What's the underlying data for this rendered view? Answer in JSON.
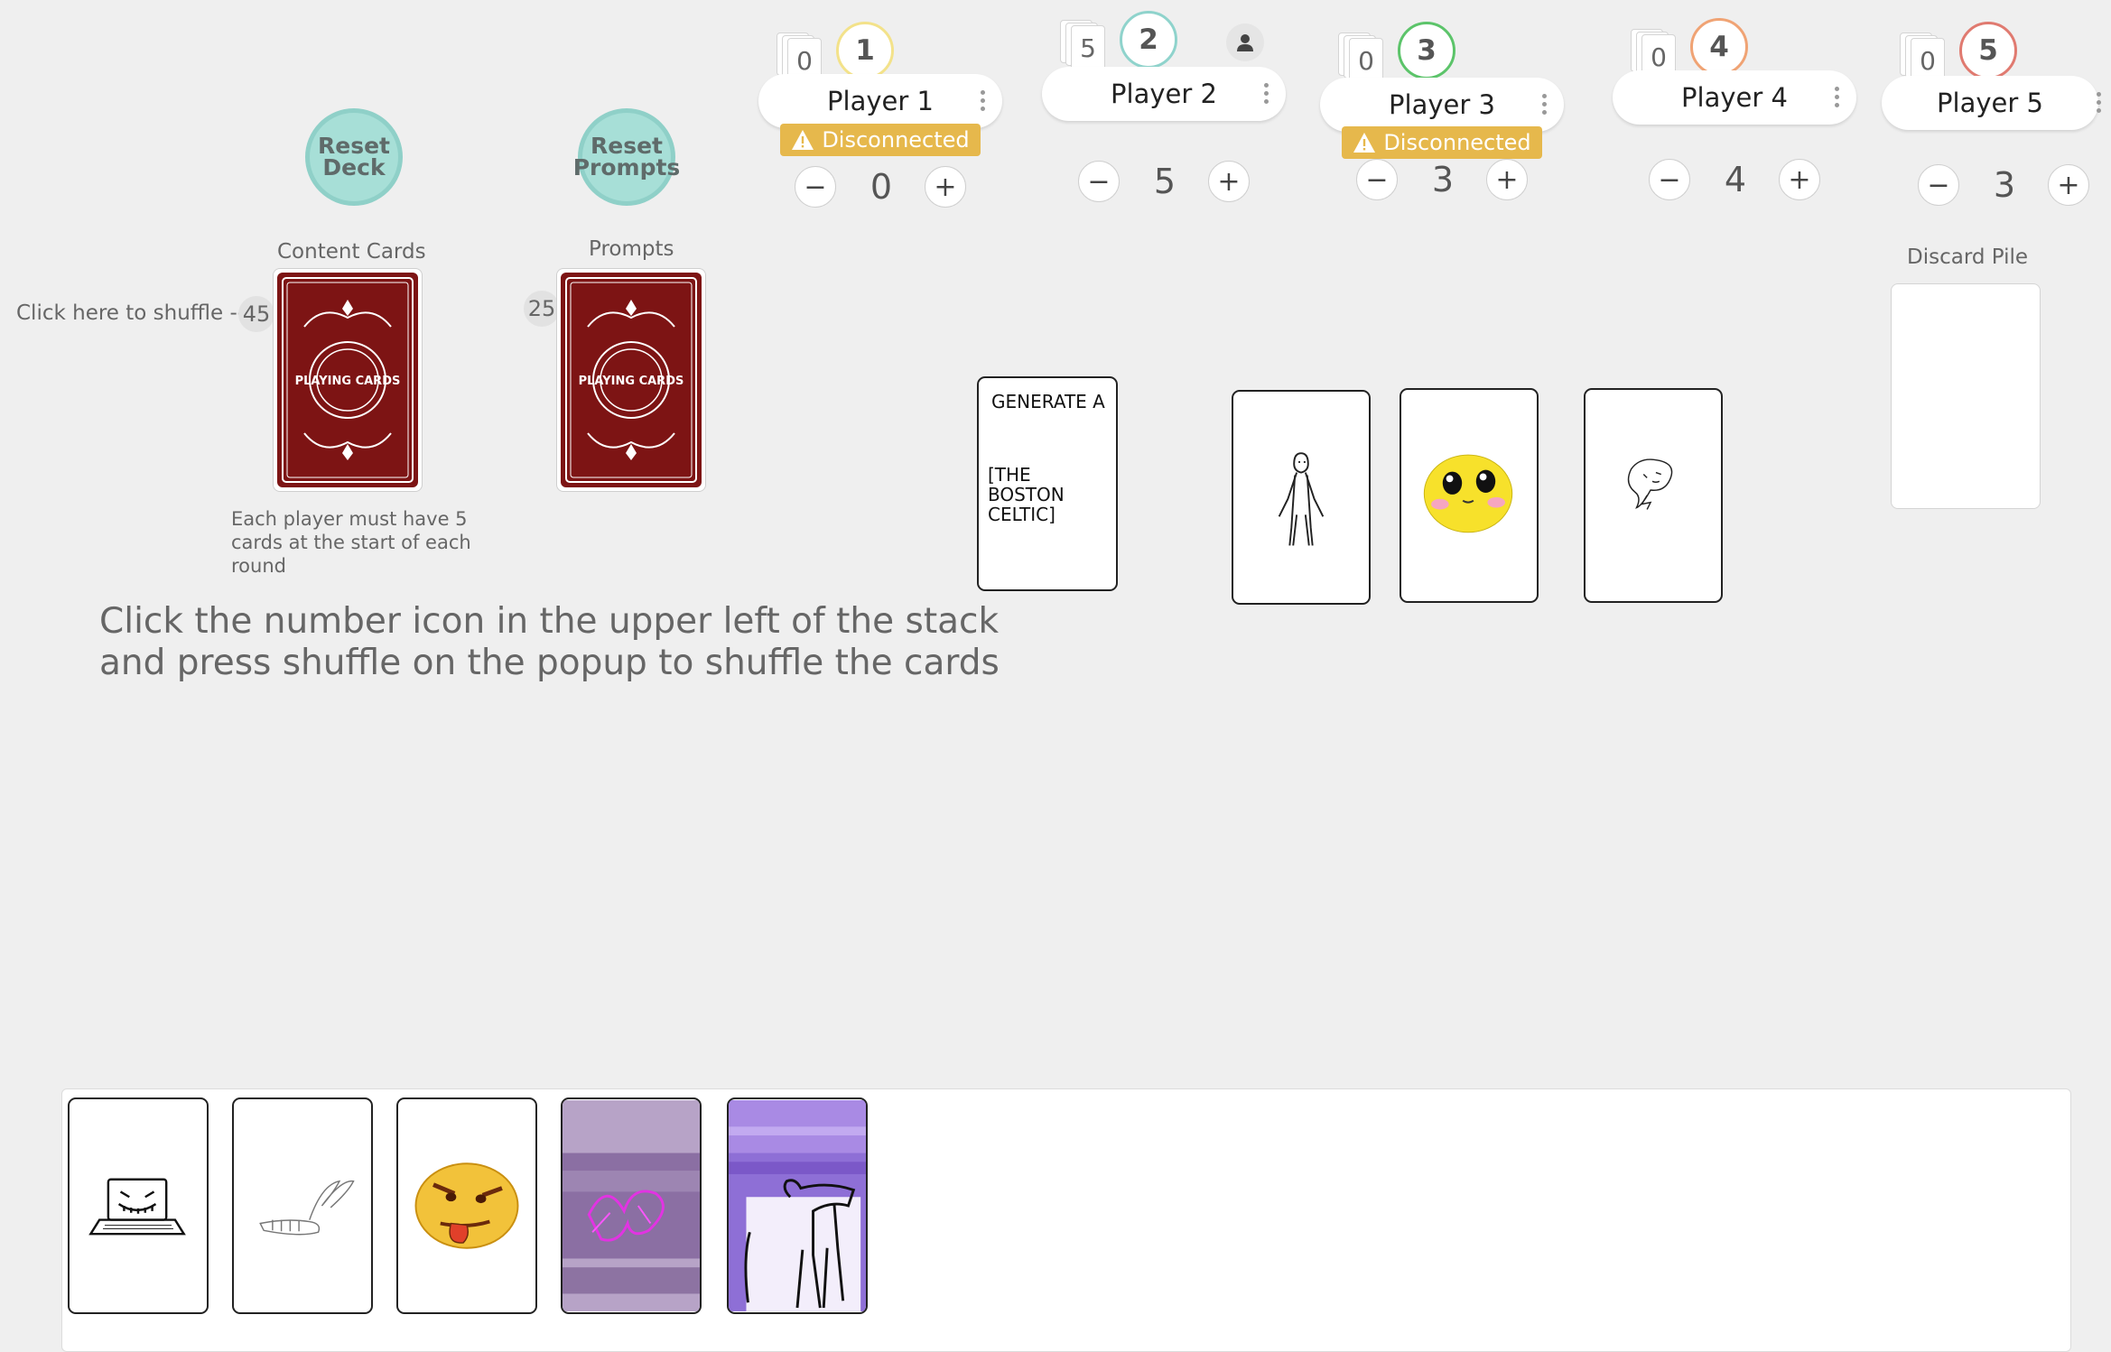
{
  "controls": {
    "reset_deck": "Reset\nDeck",
    "reset_prompts": "Reset\nPrompts"
  },
  "piles": {
    "content": {
      "label": "Content Cards",
      "count": "45",
      "shuffle_hint": "Click here to shuffle -->"
    },
    "prompts": {
      "label": "Prompts",
      "count": "25"
    },
    "discard": {
      "label": "Discard Pile"
    },
    "card_back_text": "PLAYING CARDS",
    "rules_note": "Each player must have 5 cards at the start of each round"
  },
  "instruction": "Click the number icon in the upper left of the stack and press shuffle on the popup to shuffle the cards",
  "players": [
    {
      "seat": "1",
      "name": "Player 1",
      "hand_count": "0",
      "score": "0",
      "status": "Disconnected",
      "ring_color": "#f3e28a"
    },
    {
      "seat": "2",
      "name": "Player 2",
      "hand_count": "5",
      "score": "5",
      "status": "",
      "ring_color": "#8fd3cc"
    },
    {
      "seat": "3",
      "name": "Player 3",
      "hand_count": "0",
      "score": "3",
      "status": "Disconnected",
      "ring_color": "#5cc46a"
    },
    {
      "seat": "4",
      "name": "Player 4",
      "hand_count": "0",
      "score": "4",
      "status": "",
      "ring_color": "#f0a374"
    },
    {
      "seat": "5",
      "name": "Player 5",
      "hand_count": "0",
      "score": "3",
      "status": "",
      "ring_color": "#e07a70"
    }
  ],
  "score_controls": {
    "minus": "−",
    "plus": "+"
  },
  "table": {
    "prompt_card": {
      "line1": "GENERATE A",
      "line2": "[THE\nBOSTON\nCELTIC]"
    }
  },
  "colors": {
    "background": "#efefef",
    "reset_button": "#a7dfd7",
    "card_back": "#7d1414",
    "disconnected": "#e6b84c"
  },
  "icons": {
    "warning": "warning-icon",
    "user": "user-icon",
    "menu": "kebab-menu-icon"
  }
}
